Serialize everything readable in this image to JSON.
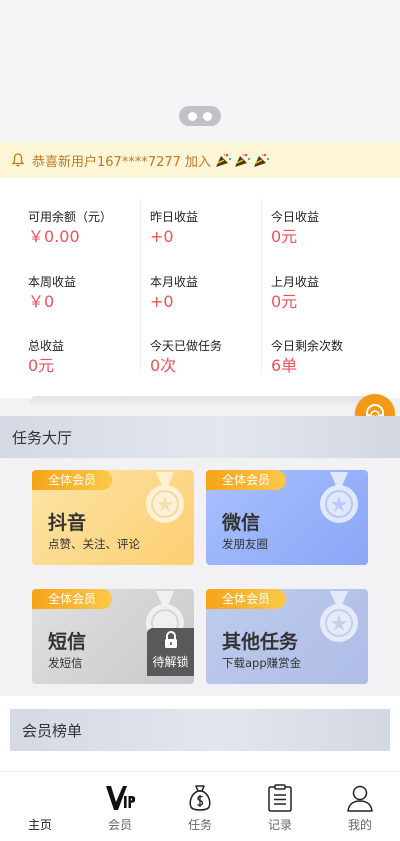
{
  "notice": {
    "text": "恭喜新用户167****7277 加入"
  },
  "stats": [
    {
      "label": "可用余额（元）",
      "value": "￥0.00"
    },
    {
      "label": "昨日收益",
      "value": "+0"
    },
    {
      "label": "今日收益",
      "value": "0元"
    },
    {
      "label": "本周收益",
      "value": "￥0"
    },
    {
      "label": "本月收益",
      "value": "+0"
    },
    {
      "label": "上月收益",
      "value": "0元"
    },
    {
      "label": "总收益",
      "value": "0元"
    },
    {
      "label": "今天已做任务",
      "value": "0次"
    },
    {
      "label": "今日剩余次数",
      "value": "6单"
    }
  ],
  "task_hall": {
    "title": "任务大厅",
    "cards": [
      {
        "tag": "全体会员",
        "title": "抖音",
        "subtitle": "点赞、关注、评论"
      },
      {
        "tag": "全体会员",
        "title": "微信",
        "subtitle": "发朋友圈"
      },
      {
        "tag": "全体会员",
        "title": "短信",
        "subtitle": "发短信",
        "lock_label": "待解锁"
      },
      {
        "tag": "全体会员",
        "title": "其他任务",
        "subtitle": "下载app赚赏金"
      }
    ]
  },
  "member_board": {
    "title": "会员榜单"
  },
  "tabbar": {
    "items": [
      {
        "label": "主页",
        "icon": "home-icon",
        "active": true
      },
      {
        "label": "会员",
        "icon": "vip-icon",
        "active": false
      },
      {
        "label": "任务",
        "icon": "money-bag-icon",
        "active": false
      },
      {
        "label": "记录",
        "icon": "clipboard-icon",
        "active": false
      },
      {
        "label": "我的",
        "icon": "user-icon",
        "active": false
      }
    ]
  },
  "colors": {
    "value_red": "#e9545a",
    "notice_text": "#c07a22",
    "notice_bg": "#fdf6d6",
    "tag_orange": "#f6a31a",
    "support_orange": "#f09a16"
  }
}
